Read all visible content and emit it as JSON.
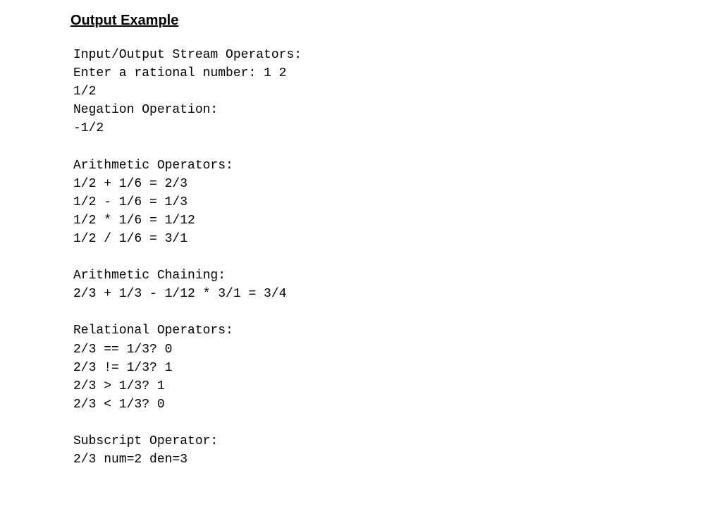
{
  "heading": "Output Example",
  "code_lines": [
    "Input/Output Stream Operators:",
    "Enter a rational number: 1 2",
    "1/2",
    "Negation Operation:",
    "-1/2",
    "",
    "Arithmetic Operators:",
    "1/2 + 1/6 = 2/3",
    "1/2 - 1/6 = 1/3",
    "1/2 * 1/6 = 1/12",
    "1/2 / 1/6 = 3/1",
    "",
    "Arithmetic Chaining:",
    "2/3 + 1/3 - 1/12 * 3/1 = 3/4",
    "",
    "Relational Operators:",
    "2/3 == 1/3? 0",
    "2/3 != 1/3? 1",
    "2/3 > 1/3? 1",
    "2/3 < 1/3? 0",
    "",
    "Subscript Operator:",
    "2/3 num=2 den=3"
  ]
}
